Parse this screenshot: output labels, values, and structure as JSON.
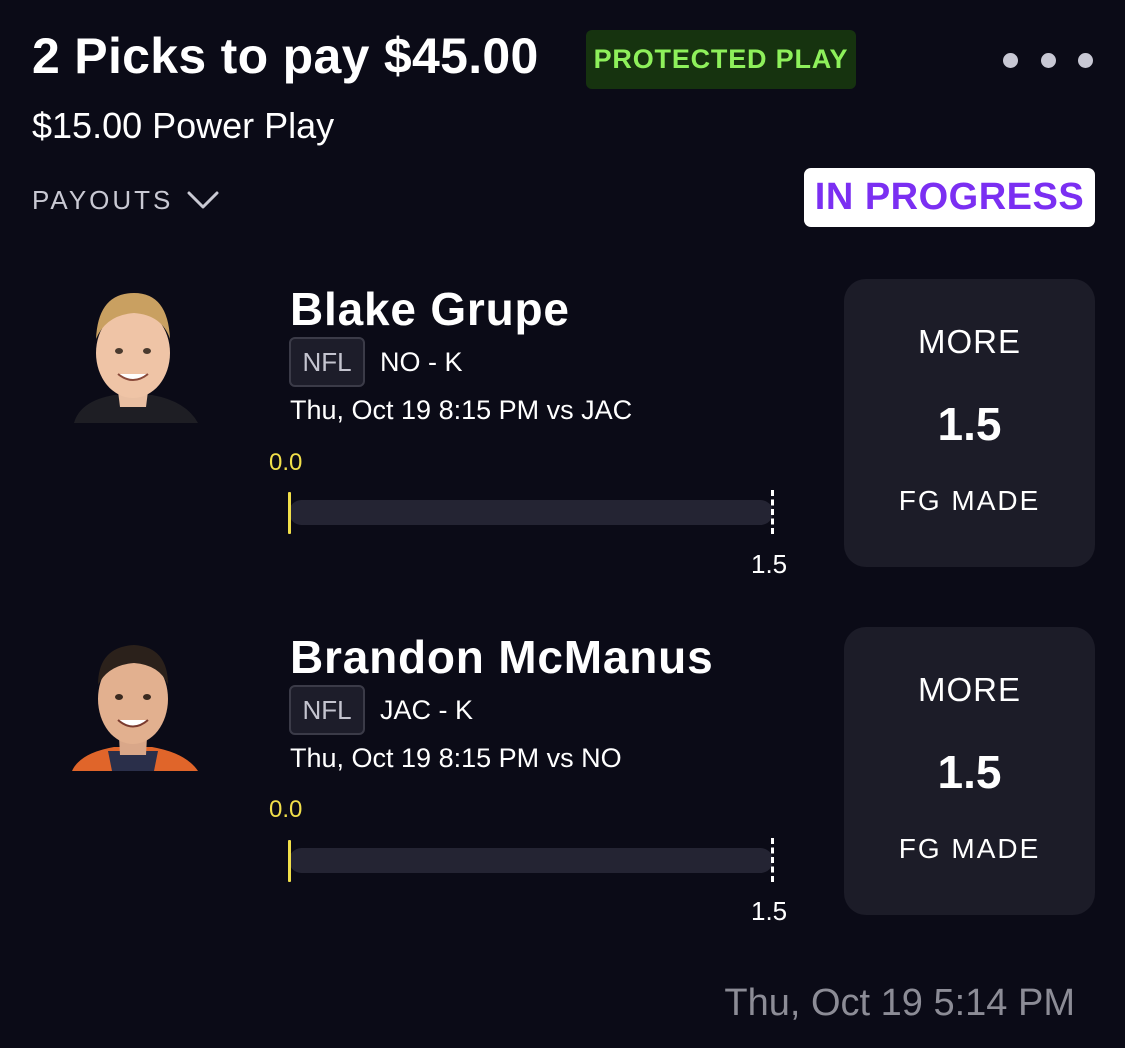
{
  "header": {
    "title": "2 Picks to pay $45.00",
    "protected_badge": "PROTECTED PLAY",
    "subtitle": "$15.00 Power Play",
    "payouts_label": "PAYOUTS",
    "status_badge": "IN PROGRESS"
  },
  "icons": {
    "more": "more-horizontal-icon",
    "payouts_toggle": "chevron-down-icon"
  },
  "colors": {
    "background": "#0b0b17",
    "protected_text": "#8ef05b",
    "protected_bg": "#16330f",
    "status_text": "#7b2ff2",
    "progress_current": "#f1df4a",
    "card_bg": "#1c1c28"
  },
  "picks": [
    {
      "player": "Blake Grupe",
      "league": "NFL",
      "team_pos": "NO - K",
      "game_time": "Thu, Oct 19 8:15 PM  vs JAC",
      "current_value": "0.0",
      "line_value": "1.5",
      "progress_fraction": 0,
      "direction": "MORE",
      "line": "1.5",
      "stat": "FG MADE"
    },
    {
      "player": "Brandon McManus",
      "league": "NFL",
      "team_pos": "JAC - K",
      "game_time": "Thu, Oct 19 8:15 PM  vs NO",
      "current_value": "0.0",
      "line_value": "1.5",
      "progress_fraction": 0,
      "direction": "MORE",
      "line": "1.5",
      "stat": "FG MADE"
    }
  ],
  "footer": {
    "timestamp": "Thu, Oct 19 5:14 PM"
  }
}
